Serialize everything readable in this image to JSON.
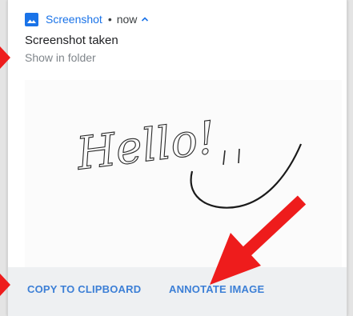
{
  "notification": {
    "app_name": "Screenshot",
    "separator": "•",
    "time": "now",
    "title": "Screenshot taken",
    "subtitle": "Show in folder",
    "preview_text": "Hello!",
    "icons": [
      "image-icon",
      "chevron-up-icon"
    ],
    "accent_color": "#1a73e8"
  },
  "actions": {
    "copy_label": "COPY TO CLIPBOARD",
    "annotate_label": "ANNOTATE IMAGE"
  },
  "annotation": {
    "arrow_color": "#ee1c1c",
    "arrows": [
      "pointer-arrow-left-top",
      "pointer-arrow-left-bottom",
      "pointer-arrow-annotate"
    ]
  }
}
